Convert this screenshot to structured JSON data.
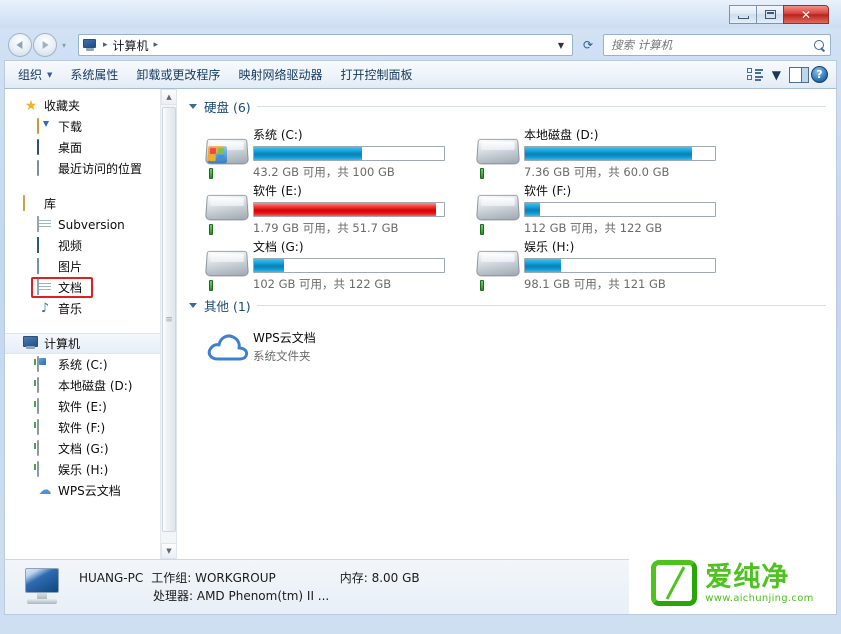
{
  "window": {
    "minimize_label": "最小化",
    "maximize_label": "最大化",
    "close_label": "关闭"
  },
  "addressbar": {
    "back_label": "后退",
    "forward_label": "前进",
    "history_label": "最近浏览的位置",
    "computer_icon": "computer-icon",
    "crumb": "计算机",
    "separator": "▸",
    "dropdown_caret": "▼",
    "refresh_label": "刷新"
  },
  "search": {
    "placeholder": "搜索 计算机",
    "value": ""
  },
  "toolbar": {
    "items": [
      {
        "label": "组织",
        "has_caret": true
      },
      {
        "label": "系统属性",
        "has_caret": false
      },
      {
        "label": "卸载或更改程序",
        "has_caret": false
      },
      {
        "label": "映射网络驱动器",
        "has_caret": false
      },
      {
        "label": "打开控制面板",
        "has_caret": false
      }
    ],
    "caret": "▼",
    "view_icon": "view-list-icon",
    "preview_pane_icon": "preview-pane-icon",
    "help_icon": "help-icon",
    "help_glyph": "?"
  },
  "sidebar": {
    "groups": [
      {
        "root": {
          "label": "收藏夹",
          "icon": "star-icon"
        },
        "children": [
          {
            "label": "下载",
            "icon": "download-folder-icon"
          },
          {
            "label": "桌面",
            "icon": "desktop-icon"
          },
          {
            "label": "最近访问的位置",
            "icon": "recent-places-icon"
          }
        ]
      },
      {
        "root": {
          "label": "库",
          "icon": "library-icon"
        },
        "children": [
          {
            "label": "Subversion",
            "icon": "document-icon"
          },
          {
            "label": "视频",
            "icon": "video-icon"
          },
          {
            "label": "图片",
            "icon": "picture-icon"
          },
          {
            "label": "文档",
            "icon": "document-icon",
            "highlighted": true
          },
          {
            "label": "音乐",
            "icon": "music-icon"
          }
        ]
      },
      {
        "root": {
          "label": "计算机",
          "icon": "computer-icon",
          "selected": true
        },
        "children": [
          {
            "label": "系统 (C:)",
            "icon": "system-drive-icon"
          },
          {
            "label": "本地磁盘 (D:)",
            "icon": "drive-icon"
          },
          {
            "label": "软件 (E:)",
            "icon": "drive-icon"
          },
          {
            "label": "软件 (F:)",
            "icon": "drive-icon"
          },
          {
            "label": "文档 (G:)",
            "icon": "drive-icon"
          },
          {
            "label": "娱乐 (H:)",
            "icon": "drive-icon"
          },
          {
            "label": "WPS云文档",
            "icon": "cloud-icon"
          }
        ]
      }
    ],
    "scroll_up": "▲",
    "scroll_down": "▼"
  },
  "content": {
    "groups": [
      {
        "title": "硬盘 (6)",
        "kind": "drives",
        "items": [
          {
            "name": "系统 (C:)",
            "icon": "system-hard-drive-icon",
            "free": "43.2 GB",
            "total": "100 GB",
            "caption": "43.2 GB 可用，共 100 GB",
            "used_percent": 57,
            "bar_color": "blue"
          },
          {
            "name": "本地磁盘 (D:)",
            "icon": "hard-drive-icon",
            "free": "7.36 GB",
            "total": "60.0 GB",
            "caption": "7.36 GB 可用，共 60.0 GB",
            "used_percent": 88,
            "bar_color": "blue"
          },
          {
            "name": "软件 (E:)",
            "icon": "hard-drive-icon",
            "free": "1.79 GB",
            "total": "51.7 GB",
            "caption": "1.79 GB 可用，共 51.7 GB",
            "used_percent": 96,
            "bar_color": "red"
          },
          {
            "name": "软件 (F:)",
            "icon": "hard-drive-icon",
            "free": "112 GB",
            "total": "122 GB",
            "caption": "112 GB 可用，共 122 GB",
            "used_percent": 8,
            "bar_color": "blue"
          },
          {
            "name": "文档 (G:)",
            "icon": "hard-drive-icon",
            "free": "102 GB",
            "total": "122 GB",
            "caption": "102 GB 可用，共 122 GB",
            "used_percent": 16,
            "bar_color": "blue"
          },
          {
            "name": "娱乐 (H:)",
            "icon": "hard-drive-icon",
            "free": "98.1 GB",
            "total": "121 GB",
            "caption": "98.1 GB 可用，共 121 GB",
            "used_percent": 19,
            "bar_color": "blue"
          }
        ]
      },
      {
        "title": "其他 (1)",
        "kind": "other",
        "items": [
          {
            "name": "WPS云文档",
            "icon": "cloud-icon",
            "subtitle": "系统文件夹"
          }
        ]
      }
    ]
  },
  "statusbar": {
    "icon": "computer-icon",
    "computer_name": "HUANG-PC",
    "workgroup_label": "工作组: WORKGROUP",
    "memory_label": "内存: 8.00 GB",
    "processor_label": "处理器: AMD Phenom(tm) II ..."
  },
  "watermark": {
    "logo_icon": "aichunjing-logo-icon",
    "brand": "爱纯净",
    "url": "www.aichunjing.com",
    "color": "#4ec21f"
  }
}
